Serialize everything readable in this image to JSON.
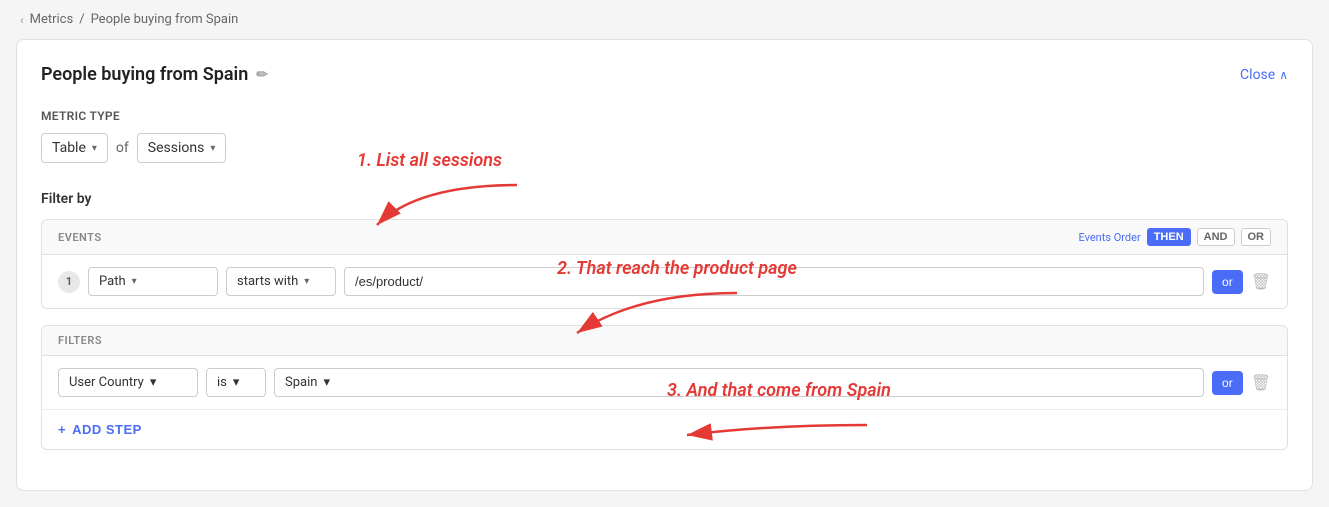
{
  "breadcrumb": {
    "parent": "Metrics",
    "separator": "/",
    "current": "People buying from Spain",
    "chevron": "‹"
  },
  "card": {
    "title": "People buying from Spain",
    "edit_icon": "✏",
    "close_label": "Close",
    "close_chevron": "∧"
  },
  "metric_type": {
    "label": "Metric Type",
    "of_text": "of",
    "type_value": "Table",
    "type_chevron": "▾",
    "sessions_value": "Sessions",
    "sessions_chevron": "▾"
  },
  "filter_by": {
    "label": "Filter by"
  },
  "events_section": {
    "header": "EVENTS",
    "events_order_label": "Events Order",
    "order_buttons": [
      {
        "label": "THEN",
        "active": true
      },
      {
        "label": "AND",
        "active": false
      },
      {
        "label": "OR",
        "active": false
      }
    ],
    "row": {
      "number": "1",
      "path_label": "Path",
      "path_chevron": "▾",
      "condition_label": "starts with",
      "condition_chevron": "▾",
      "value": "/es/product/",
      "or_label": "or",
      "delete_icon": "🗑"
    }
  },
  "filters_section": {
    "header": "FILTERS",
    "row": {
      "country_label": "User Country",
      "country_chevron": "▾",
      "is_label": "is",
      "is_chevron": "▾",
      "spain_value": "Spain",
      "spain_chevron": "▾",
      "or_label": "or",
      "delete_icon": "🗑"
    }
  },
  "add_step": {
    "plus": "+",
    "label": "ADD STEP"
  },
  "annotations": [
    {
      "id": "ann1",
      "text": "1. List all sessions"
    },
    {
      "id": "ann2",
      "text": "2. That reach the product page"
    },
    {
      "id": "ann3",
      "text": "3. And that come from Spain"
    }
  ]
}
